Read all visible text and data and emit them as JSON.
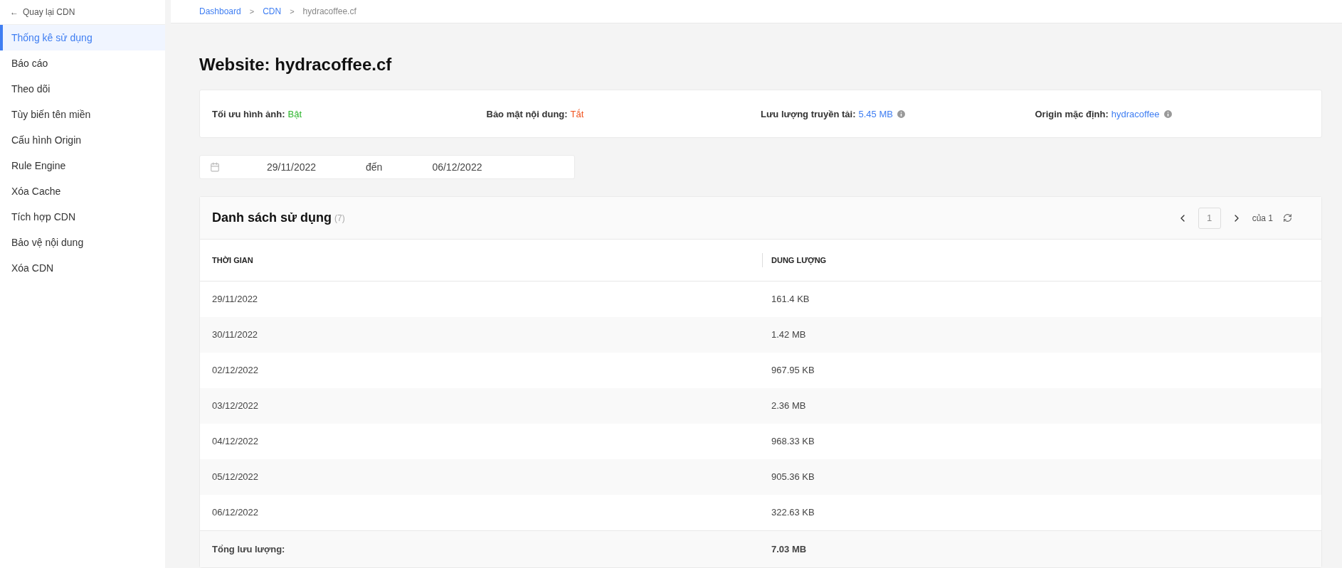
{
  "sidebar": {
    "back": {
      "icon": "←",
      "label": "Quay lại CDN"
    },
    "items": [
      {
        "label": "Thống kê sử dụng",
        "selected": true
      },
      {
        "label": "Báo cáo",
        "selected": false
      },
      {
        "label": "Theo dõi",
        "selected": false
      },
      {
        "label": "Tùy biến tên miền",
        "selected": false
      },
      {
        "label": "Cấu hình Origin",
        "selected": false
      },
      {
        "label": "Rule Engine",
        "selected": false
      },
      {
        "label": "Xóa Cache",
        "selected": false
      },
      {
        "label": "Tích hợp CDN",
        "selected": false
      },
      {
        "label": "Bảo vệ nội dung",
        "selected": false
      },
      {
        "label": "Xóa CDN",
        "selected": false
      }
    ]
  },
  "breadcrumb": [
    {
      "label": "Dashboard",
      "kind": "link"
    },
    {
      "separator": ">",
      "label": "CDN",
      "kind": "link"
    },
    {
      "separator": ">",
      "label": "hydracoffee.cf",
      "kind": "current"
    }
  ],
  "page_title": "Website: hydracoffee.cf",
  "summary": [
    {
      "label": "Tối ưu hình ảnh:",
      "value": "Bật",
      "kind": "on",
      "info": false
    },
    {
      "label": "Bảo mật nội dung:",
      "value": "Tắt",
      "kind": "off",
      "info": false
    },
    {
      "label": "Lưu lượng truyền tải:",
      "value": "5.45 MB",
      "kind": "link",
      "info": true
    },
    {
      "label": "Origin mặc định:",
      "value": "hydracoffee",
      "kind": "link",
      "info": true
    }
  ],
  "date_range": {
    "from": "29/11/2022",
    "separator": "đến",
    "to": "06/12/2022"
  },
  "table": {
    "title": "Danh sách sử dụng",
    "count": "(7)",
    "pagination": {
      "page": "1",
      "of": "của 1"
    },
    "columns": [
      "THỜI GIAN",
      "DUNG LƯỢNG"
    ],
    "rows": [
      [
        "29/11/2022",
        "161.4 KB"
      ],
      [
        "30/11/2022",
        "1.42 MB"
      ],
      [
        "02/12/2022",
        "967.95 KB"
      ],
      [
        "03/12/2022",
        "2.36 MB"
      ],
      [
        "04/12/2022",
        "968.33 KB"
      ],
      [
        "05/12/2022",
        "905.36 KB"
      ],
      [
        "06/12/2022",
        "322.63 KB"
      ]
    ],
    "footer": {
      "label": "Tổng lưu lượng:",
      "value": "7.03 MB"
    }
  }
}
